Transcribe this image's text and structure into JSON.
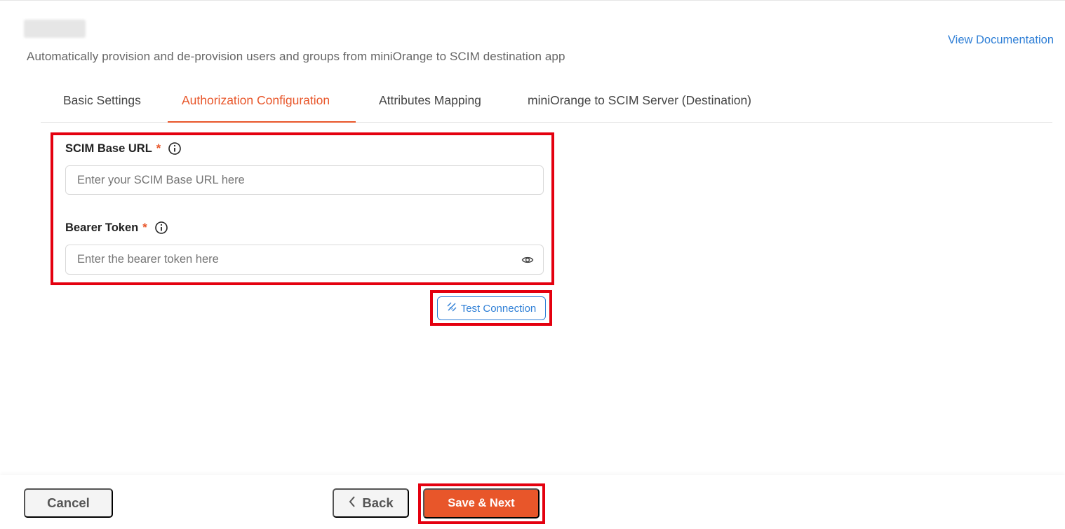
{
  "header": {
    "subtitle": "Automatically provision and de-provision users and groups from miniOrange to SCIM destination app",
    "view_documentation": "View Documentation"
  },
  "tabs": [
    {
      "label": "Basic Settings",
      "active": false
    },
    {
      "label": "Authorization Configuration",
      "active": true
    },
    {
      "label": "Attributes Mapping",
      "active": false
    },
    {
      "label": "miniOrange to SCIM Server (Destination)",
      "active": false
    }
  ],
  "form": {
    "scim_base_url": {
      "label": "SCIM Base URL",
      "required_mark": "*",
      "placeholder": "Enter your SCIM Base URL here",
      "value": ""
    },
    "bearer_token": {
      "label": "Bearer Token",
      "required_mark": "*",
      "placeholder": "Enter the bearer token here",
      "value": ""
    },
    "test_connection": "Test Connection"
  },
  "footer": {
    "cancel": "Cancel",
    "back": "Back",
    "save_next": "Save & Next"
  },
  "colors": {
    "accent": "#e8562a",
    "link": "#2f7fd6",
    "highlight": "#e4000f"
  },
  "icons": [
    "info-icon",
    "eye-icon",
    "connection-icon",
    "chevron-left-icon"
  ]
}
